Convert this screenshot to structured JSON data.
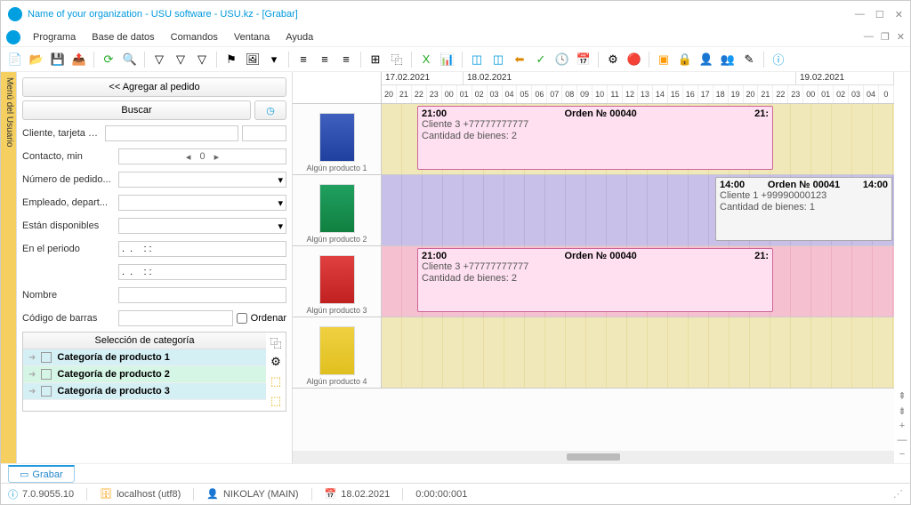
{
  "title": "Name of your organization - USU software - USU.kz - [Grabar]",
  "menu": {
    "programa": "Programa",
    "basedatos": "Base de datos",
    "comandos": "Comandos",
    "ventana": "Ventana",
    "ayuda": "Ayuda"
  },
  "usertab": "Menú del Usuario",
  "left": {
    "add": "<< Agregar al pedido",
    "search": "Buscar",
    "fields": {
      "cliente": "Cliente, tarjeta no.",
      "contacto": "Contacto, min",
      "contacto_val": "0",
      "numpedido": "Número de pedido...",
      "empleado": "Empleado, depart...",
      "disponibles": "Están disponibles",
      "periodo": "En el periodo",
      "periodo_val": ".  .    : :",
      "nombre": "Nombre",
      "codigo": "Código de barras",
      "ordenar": "Ordenar"
    },
    "cat_header": "Selección de categoría",
    "cats": [
      "Categoría de producto 1",
      "Categoría de producto 2",
      "Categoría de producto 3"
    ]
  },
  "timeline": {
    "dates": [
      "17.02.2021",
      "18.02.2021",
      "19.02.2021"
    ],
    "hours1": [
      "20",
      "21",
      "22",
      "23"
    ],
    "hours2": [
      "00",
      "01",
      "02",
      "03",
      "04",
      "05",
      "06",
      "07",
      "08",
      "09",
      "10",
      "11",
      "12",
      "13",
      "14",
      "15",
      "16",
      "17",
      "18",
      "19",
      "20",
      "21",
      "22",
      "23"
    ],
    "hours3": [
      "00",
      "01",
      "02",
      "03",
      "04",
      "0"
    ],
    "products": [
      "Algún producto 1",
      "Algún producto 2",
      "Algún producto 3",
      "Algún producto 4"
    ],
    "order40": {
      "title": "Orden № 00040",
      "t1": "21:00",
      "t2": "21:",
      "line1": "Cliente 3 +77777777777",
      "line2": "Cantidad de bienes: 2"
    },
    "order41": {
      "title": "Orden № 00041",
      "t1": "14:00",
      "t2": "14:00",
      "line1": "Cliente 1 +99990000123",
      "line2": "Cantidad de bienes: 1"
    }
  },
  "tab": "Grabar",
  "status": {
    "ver": "7.0.9055.10",
    "host": "localhost (utf8)",
    "user": "NIKOLAY (MAIN)",
    "date": "18.02.2021",
    "time": "0:00:00:001"
  }
}
